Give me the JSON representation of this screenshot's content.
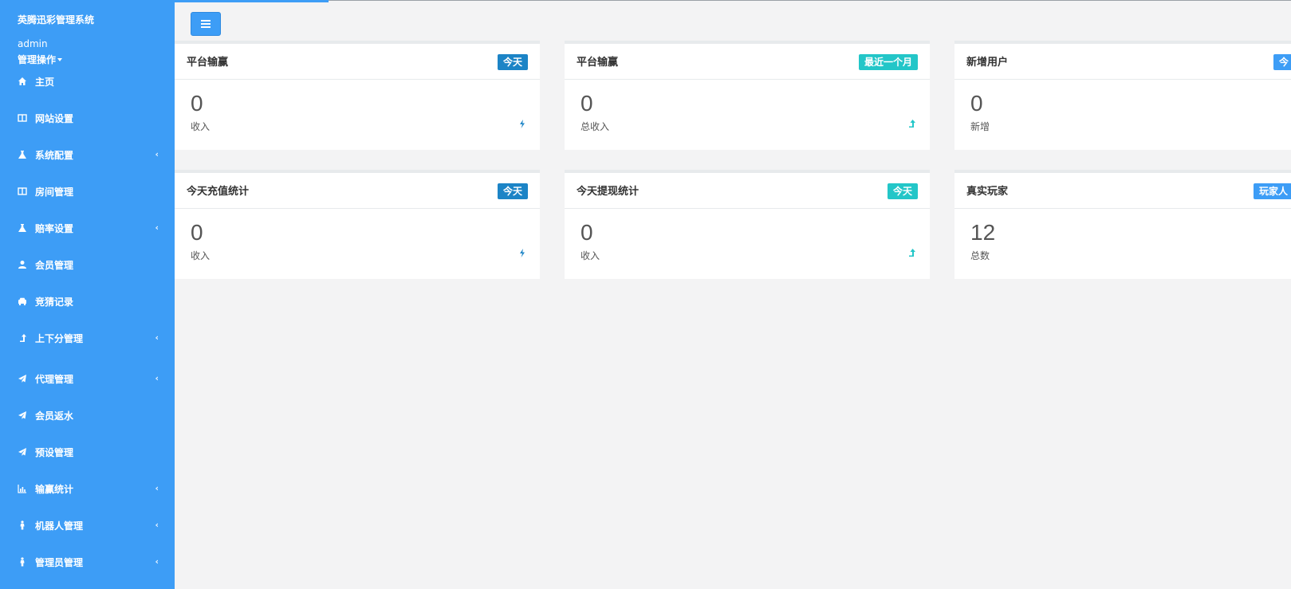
{
  "brand": {
    "title": "英腾迅彩管理系统",
    "user": "admin",
    "ops": "管理操作"
  },
  "nav": [
    {
      "label": "主页",
      "icon": "home-icon",
      "arrow": ""
    },
    {
      "label": "网站设置",
      "icon": "columns-icon",
      "arrow": ""
    },
    {
      "label": "系统配置",
      "icon": "flask-icon",
      "arrow": "‹"
    },
    {
      "label": "房间管理",
      "icon": "columns-icon",
      "arrow": ""
    },
    {
      "label": "赔率设置",
      "icon": "flask-icon",
      "arrow": "‹"
    },
    {
      "label": "会员管理",
      "icon": "user-icon",
      "arrow": ""
    },
    {
      "label": "竞猜记录",
      "icon": "car-icon",
      "arrow": ""
    },
    {
      "label": "上下分管理",
      "icon": "level-up-icon",
      "arrow": "‹"
    },
    {
      "label": "代理管理",
      "icon": "paper-plane-icon",
      "arrow": "‹"
    },
    {
      "label": "会员返水",
      "icon": "paper-plane-icon",
      "arrow": ""
    },
    {
      "label": "预设管理",
      "icon": "paper-plane-icon",
      "arrow": ""
    },
    {
      "label": "输赢统计",
      "icon": "bar-chart-icon",
      "arrow": "‹"
    },
    {
      "label": "机器人管理",
      "icon": "male-icon",
      "arrow": "‹"
    },
    {
      "label": "管理员管理",
      "icon": "male-icon",
      "arrow": "‹"
    }
  ],
  "cards": [
    {
      "title": "平台输赢",
      "badge": "今天",
      "badge_color": "#1c84c6",
      "value": "0",
      "label": "收入",
      "stat_icon": "bolt-icon"
    },
    {
      "title": "平台输赢",
      "badge": "最近一个月",
      "badge_color": "#23c6c8",
      "value": "0",
      "label": "总收入",
      "stat_icon": "level-up-icon"
    },
    {
      "title": "新增用户",
      "badge": "今",
      "badge_color": "#3d9df6",
      "value": "0",
      "label": "新增",
      "stat_icon": ""
    },
    {
      "title": "今天充值统计",
      "badge": "今天",
      "badge_color": "#1c84c6",
      "value": "0",
      "label": "收入",
      "stat_icon": "bolt-icon"
    },
    {
      "title": "今天提现统计",
      "badge": "今天",
      "badge_color": "#23c6c8",
      "value": "0",
      "label": "收入",
      "stat_icon": "level-up-icon"
    },
    {
      "title": "真实玩家",
      "badge": "玩家人",
      "badge_color": "#3d9df6",
      "value": "12",
      "label": "总数",
      "stat_icon": ""
    }
  ],
  "colors": {
    "sidebar": "#3d9df6",
    "primary": "#1c84c6",
    "info": "#23c6c8"
  }
}
